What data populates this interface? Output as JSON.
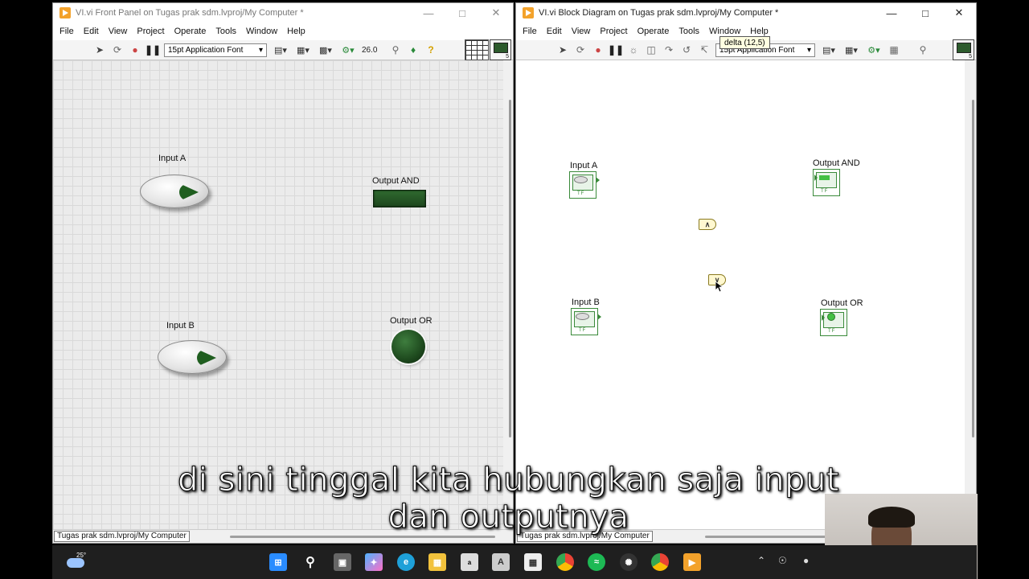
{
  "front_panel": {
    "title": "VI.vi Front Panel on Tugas prak sdm.lvproj/My Computer *",
    "menu": [
      "File",
      "Edit",
      "View",
      "Project",
      "Operate",
      "Tools",
      "Window",
      "Help"
    ],
    "font_select": "15pt Application Font",
    "zoom": "26.0",
    "status": "Tugas prak sdm.lvproj/My Computer",
    "controls": {
      "input_a": "Input A",
      "input_b": "Input B",
      "output_and": "Output AND",
      "output_or": "Output OR"
    }
  },
  "block_diagram": {
    "title": "VI.vi Block Diagram on Tugas prak sdm.lvproj/My Computer *",
    "menu": [
      "File",
      "Edit",
      "View",
      "Project",
      "Operate",
      "Tools",
      "Window",
      "Help"
    ],
    "font_select": "15pt Application Font",
    "tooltip": "delta (12,5)",
    "status": "Tugas prak sdm.lvproj/My Computer",
    "terminals": {
      "input_a": "Input A",
      "input_b": "Input B",
      "output_and": "Output AND",
      "output_or": "Output OR"
    },
    "gates": {
      "and_symbol": "∧",
      "or_symbol": "∨"
    }
  },
  "subtitle": {
    "line1": "di sini tinggal kita hubungkan saja input",
    "line2": "dan outputnya"
  },
  "taskbar": {
    "temperature": "25°"
  },
  "colors": {
    "led_dark_green": "#1d461d",
    "terminal_green": "#3a8a3a",
    "labview_orange": "#f3a22b"
  }
}
